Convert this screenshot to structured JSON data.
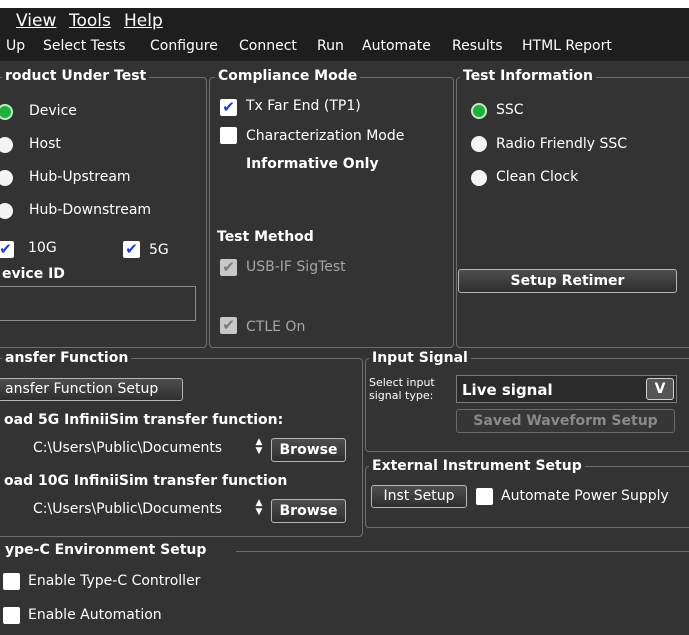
{
  "menu": {
    "view": "View",
    "tools": "Tools",
    "help": "Help"
  },
  "tabs": [
    "Up",
    "Select Tests",
    "Configure",
    "Connect",
    "Run",
    "Automate",
    "Results",
    "HTML Report"
  ],
  "product": {
    "title": "roduct Under Test",
    "options": [
      "Device",
      "Host",
      "Hub-Upstream",
      "Hub-Downstream"
    ],
    "selected": "Device",
    "cb_10g": "10G",
    "cb_5g": "5G",
    "device_id_label": "evice ID",
    "device_id_value": ""
  },
  "compliance": {
    "title": "Compliance Mode",
    "tx_far_end": "Tx Far End (TP1)",
    "tx_far_end_checked": true,
    "characterization": "Characterization Mode",
    "characterization_checked": false,
    "informative": "Informative Only",
    "test_method_title": "Test Method",
    "usb_sigtest": "USB-IF SigTest",
    "ctle_on": "CTLE On"
  },
  "test_info": {
    "title": "Test Information",
    "options": [
      "SSC",
      "Radio Friendly SSC",
      "Clean Clock"
    ],
    "selected": "SSC",
    "setup_retimer": "Setup Retimer"
  },
  "transfer": {
    "title": "ansfer Function",
    "setup_button": "ansfer Function Setup",
    "load5_label": "oad 5G InfiniiSim transfer function:",
    "load5_path": "C:\\Users\\Public\\Documents",
    "load10_label": "oad 10G InfiniiSim transfer function",
    "load10_path": "C:\\Users\\Public\\Documents",
    "browse": "Browse"
  },
  "input_signal": {
    "title": "Input Signal",
    "select_label_1": "Select input",
    "select_label_2": "signal type:",
    "selected": "Live signal",
    "saved_waveform": "Saved Waveform Setup"
  },
  "external": {
    "title": "External Instrument Setup",
    "inst_setup": "Inst Setup",
    "automate_power": "Automate Power Supply"
  },
  "typec": {
    "title": "ype-C Environment Setup",
    "enable_controller": "Enable Type-C Controller",
    "enable_automation": "Enable Automation"
  },
  "colors": {
    "background": "#333333",
    "accent_green": "#22b03c",
    "check_blue": "#1b3fd0"
  },
  "icons": {
    "check": "✔",
    "dropdown": "chevron-down-icon",
    "spinner": "spinner-updown-icon"
  }
}
